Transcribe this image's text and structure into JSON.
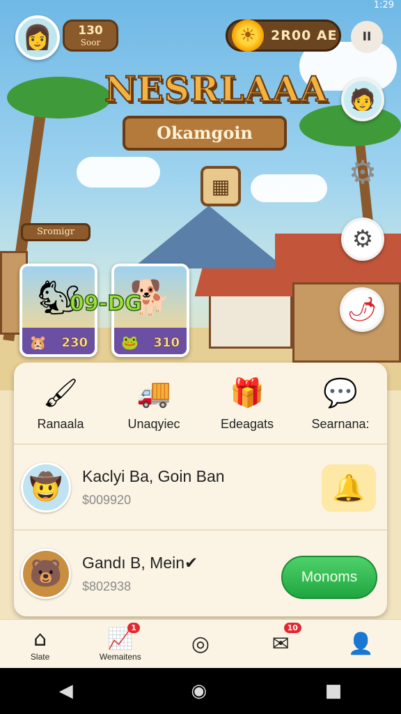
{
  "status_bar": {
    "time": "1:29"
  },
  "hud": {
    "avatar_icon": "player-avatar-icon",
    "level_value": "130",
    "level_caption": "Soor",
    "coins_value": "2R00 AE",
    "pause_label": "II"
  },
  "title": {
    "main": "NESRLAAA",
    "subtitle": "Okamgoin"
  },
  "sign": {
    "text": "Sromigr"
  },
  "items": [
    {
      "badge": "09-DG",
      "price": "230"
    },
    {
      "price": "310"
    }
  ],
  "actions": [
    {
      "label": "Ranaala",
      "icon": "brush-icon"
    },
    {
      "label": "Unaqyiec",
      "icon": "truck-icon"
    },
    {
      "label": "Edeagats",
      "icon": "gift-box-icon"
    },
    {
      "label": "Searnana:",
      "icon": "person-chat-icon"
    }
  ],
  "rows": [
    {
      "name": "Kaclyi Ba, Goin Ban",
      "amount": "$009920",
      "button": "bell-icon"
    },
    {
      "name": "Gandı B, Mein✔",
      "amount": "$802938",
      "button_label": "Monoms"
    }
  ],
  "nav": [
    {
      "label": "Slate",
      "icon": "home-icon"
    },
    {
      "label": "Wemaitens",
      "icon": "chart-icon",
      "badge": "1"
    },
    {
      "label": "",
      "icon": "target-icon"
    },
    {
      "label": "",
      "icon": "mail-icon",
      "badge": "10"
    },
    {
      "label": "",
      "icon": "profile-icon"
    }
  ],
  "colors": {
    "accent_green": "#20a640",
    "title_orange": "#f3b341",
    "wood": "#8b5a2b",
    "badge_red": "#e5262d"
  }
}
